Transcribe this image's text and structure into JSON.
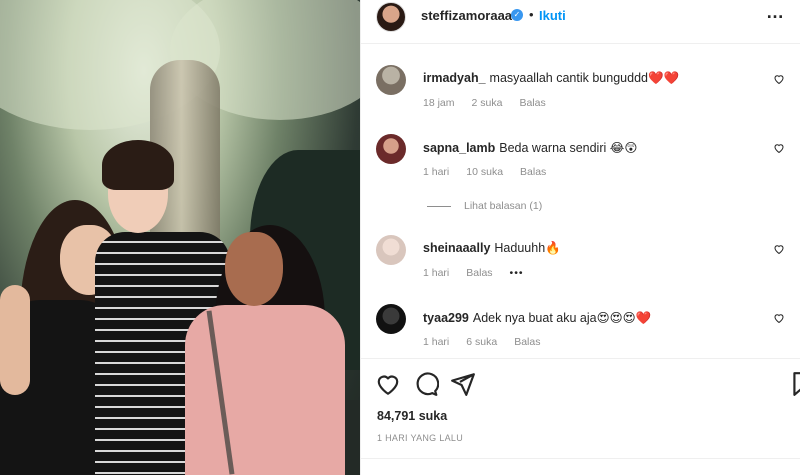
{
  "post": {
    "author": "steffizamoraaa",
    "separator": "•",
    "follow_label": "Ikuti",
    "likes": "84,791 suka",
    "time_ago": "1 HARI YANG LALU"
  },
  "comments": [
    {
      "user": "irmadyah_",
      "text": "masyaallah cantik bunguddd",
      "emoji": "❤️❤️",
      "time": "18 jam",
      "likes": "2 suka",
      "reply": "Balas"
    },
    {
      "user": "sapna_lamb",
      "text": "Beda warna sendiri",
      "emoji": "😂😲",
      "time": "1 hari",
      "likes": "10 suka",
      "reply": "Balas"
    },
    {
      "user": "sheinaaally",
      "text": "Haduuhh",
      "emoji": "🔥",
      "time": "1 hari",
      "reply": "Balas",
      "more": "•••"
    },
    {
      "user": "tyaa299",
      "text": "Adek nya buat aku aja",
      "emoji": "😍😍😍❤️",
      "time": "1 hari",
      "likes": "6 suka",
      "reply": "Balas"
    }
  ],
  "view_replies": "Lihat balasan (1)",
  "colors": {
    "accent": "#0095f6",
    "verified": "#3897f0",
    "muted": "#8e8e8e",
    "heart": "#ed4956"
  },
  "icons": [
    "heart-icon",
    "comment-icon",
    "share-icon",
    "bookmark-icon",
    "verified-badge-icon",
    "more-options-icon"
  ]
}
